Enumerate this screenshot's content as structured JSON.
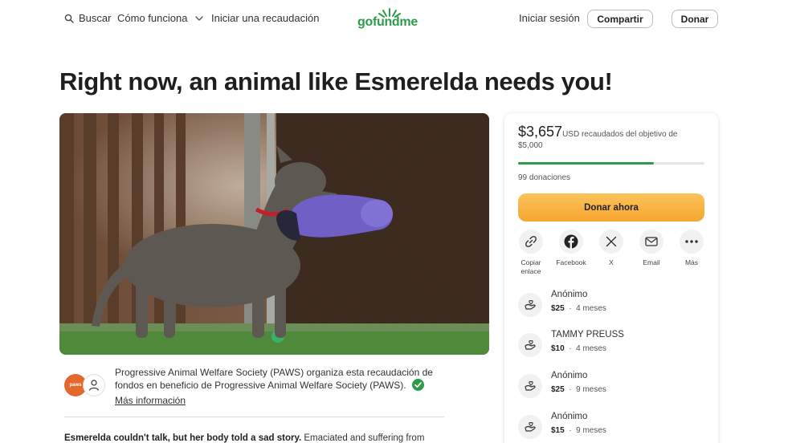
{
  "header": {
    "search_label": "Buscar",
    "how_it_works_label": "Cómo funciona",
    "start_label": "Iniciar una recaudación",
    "logo_text": "gofundme",
    "login_label": "Iniciar sesión",
    "share_label": "Compartir",
    "donate_label": "Donar"
  },
  "page": {
    "title": "Right now, an animal like Esmerelda needs you!"
  },
  "organizer": {
    "avatar_text": "paws",
    "text": "Progressive Animal Welfare Society (PAWS) organiza esta recaudación de fondos en beneficio de Progressive Animal Welfare Society (PAWS).",
    "more_info_label": "Más información"
  },
  "story": {
    "lead": "Esmerelda couldn't talk, but her body told a sad story.",
    "rest": "Emaciated and suffering from"
  },
  "donation_card": {
    "amount": "$3,657",
    "currency_text": "USD recaudados del objetivo de",
    "goal": "$5,000",
    "progress_fraction": 0.73,
    "donations_count": "99 donaciones",
    "donate_now_label": "Donar ahora",
    "share_options": [
      {
        "label": "Copiar enlace",
        "icon": "link-icon"
      },
      {
        "label": "Facebook",
        "icon": "facebook-icon"
      },
      {
        "label": "X",
        "icon": "x-icon"
      },
      {
        "label": "Email",
        "icon": "email-icon"
      },
      {
        "label": "Más",
        "icon": "more-icon"
      }
    ],
    "donors": [
      {
        "name": "Anónimo",
        "amount": "$25",
        "time": "4 meses"
      },
      {
        "name": "TAMMY PREUSS",
        "amount": "$10",
        "time": "4 meses"
      },
      {
        "name": "Anónimo",
        "amount": "$25",
        "time": "9 meses"
      },
      {
        "name": "Anónimo",
        "amount": "$15",
        "time": "9 meses"
      }
    ]
  },
  "colors": {
    "brand_green": "#2f9a48",
    "donate_orange": "#f6a530"
  }
}
